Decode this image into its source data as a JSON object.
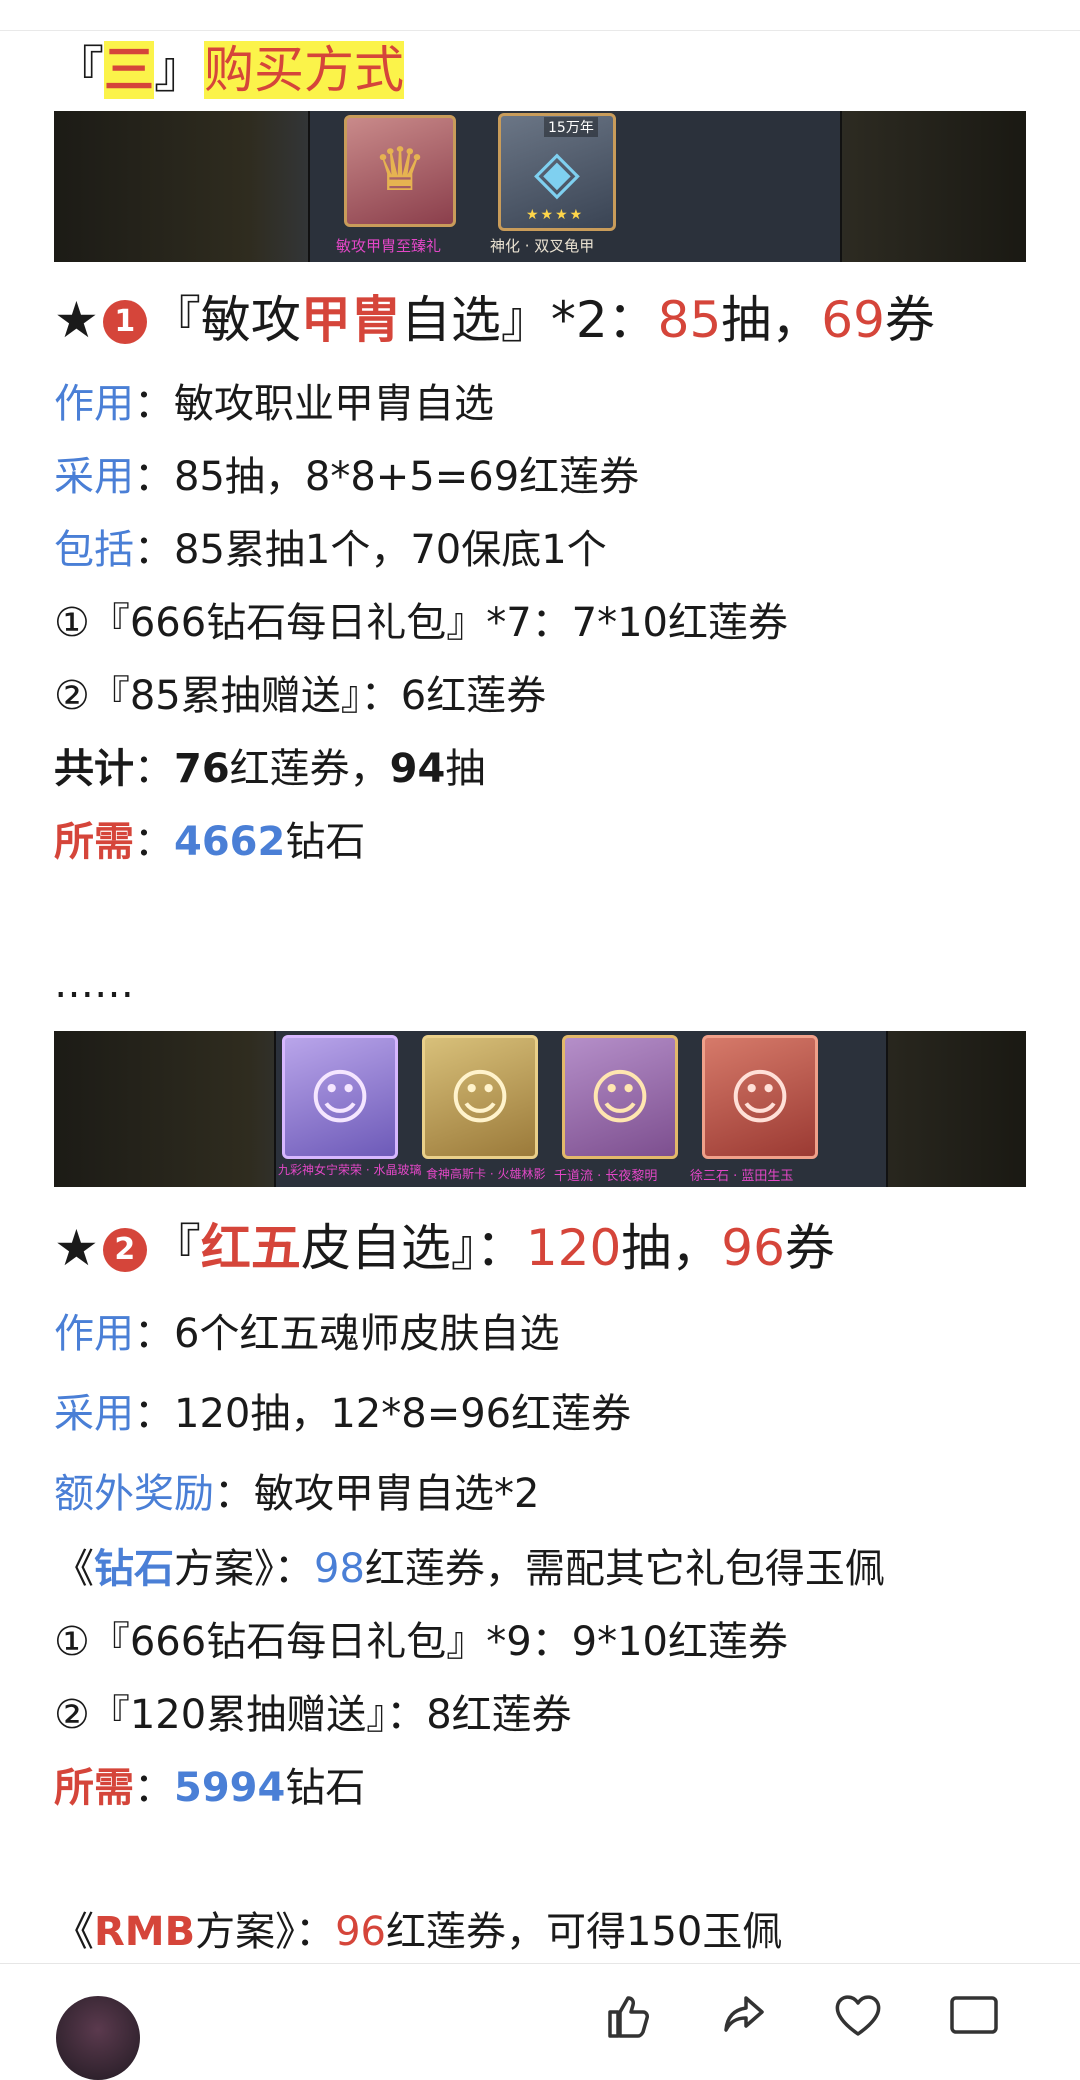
{
  "section": {
    "bracket_open": "『",
    "number": "三",
    "bracket_close": "』",
    "title": "购买方式"
  },
  "banner1": {
    "card1_caption": "敏攻甲胄至臻礼",
    "card2_caption": "神化 · 双叉龟甲",
    "card2_tag": "15万年",
    "card2_stars": "★★★★"
  },
  "block1": {
    "star": "★",
    "badge": "1",
    "title_pre": "『敏攻",
    "title_red": "甲胄",
    "title_post": "自选』*2：",
    "draws": "85",
    "draws_unit": "抽，",
    "tickets": "69",
    "tickets_unit": "券",
    "effect_label": "作用",
    "effect_text": "：敏攻职业甲胄自选",
    "adopt_label": "采用",
    "adopt_text": "：85抽，8*8+5=69红莲券",
    "include_label": "包括",
    "include_text": "：85累抽1个，70保底1个",
    "item1": "①『666钻石每日礼包』*7：7*10红莲券",
    "item2": "②『85累抽赠送』：6红莲券",
    "total_label": "共计",
    "total_sep": "：",
    "total_tickets": "76",
    "total_tickets_unit": "红莲券，",
    "total_draws": "94",
    "total_draws_unit": "抽",
    "need_label": "所需",
    "need_sep": "：",
    "need_value": "4662",
    "need_unit": "钻石"
  },
  "ellipsis": "……",
  "banner2": {
    "captions": [
      "九彩神女宁荣荣 · 水晶玻璃",
      "食神高斯卡 · 火雄林影",
      "千道流 · 长夜黎明",
      "徐三石 · 蓝田生玉"
    ]
  },
  "block2": {
    "star": "★",
    "badge": "2",
    "title_pre": "『",
    "title_red": "红五",
    "title_post": "皮自选』：",
    "draws": "120",
    "draws_unit": "抽，",
    "tickets": "96",
    "tickets_unit": "券",
    "effect_label": "作用",
    "effect_text": "：6个红五魂师皮肤自选",
    "adopt_label": "采用",
    "adopt_text": "：120抽，12*8=96红莲券",
    "bonus_label": "额外奖励",
    "bonus_text": "：敏攻甲胄自选*2",
    "diamond_pre": "《",
    "diamond_blue": "钻石",
    "diamond_mid": "方案》：",
    "diamond_num": "98",
    "diamond_post": "红莲券，需配其它礼包得玉佩",
    "item1": "①『666钻石每日礼包』*9：9*10红莲券",
    "item2": "②『120累抽赠送』：8红莲券",
    "need_label": "所需",
    "need_sep": "：",
    "need_value": "5994",
    "need_unit": "钻石",
    "rmb_pre": "《",
    "rmb_red": "RMB",
    "rmb_mid": "方案》：",
    "rmb_num": "96",
    "rmb_post": "红莲券，可得150玉佩"
  },
  "bottom_bar": {
    "icons": [
      "avatar",
      "thumbs-up-icon",
      "share-icon",
      "heart-icon",
      "comment-icon"
    ]
  }
}
